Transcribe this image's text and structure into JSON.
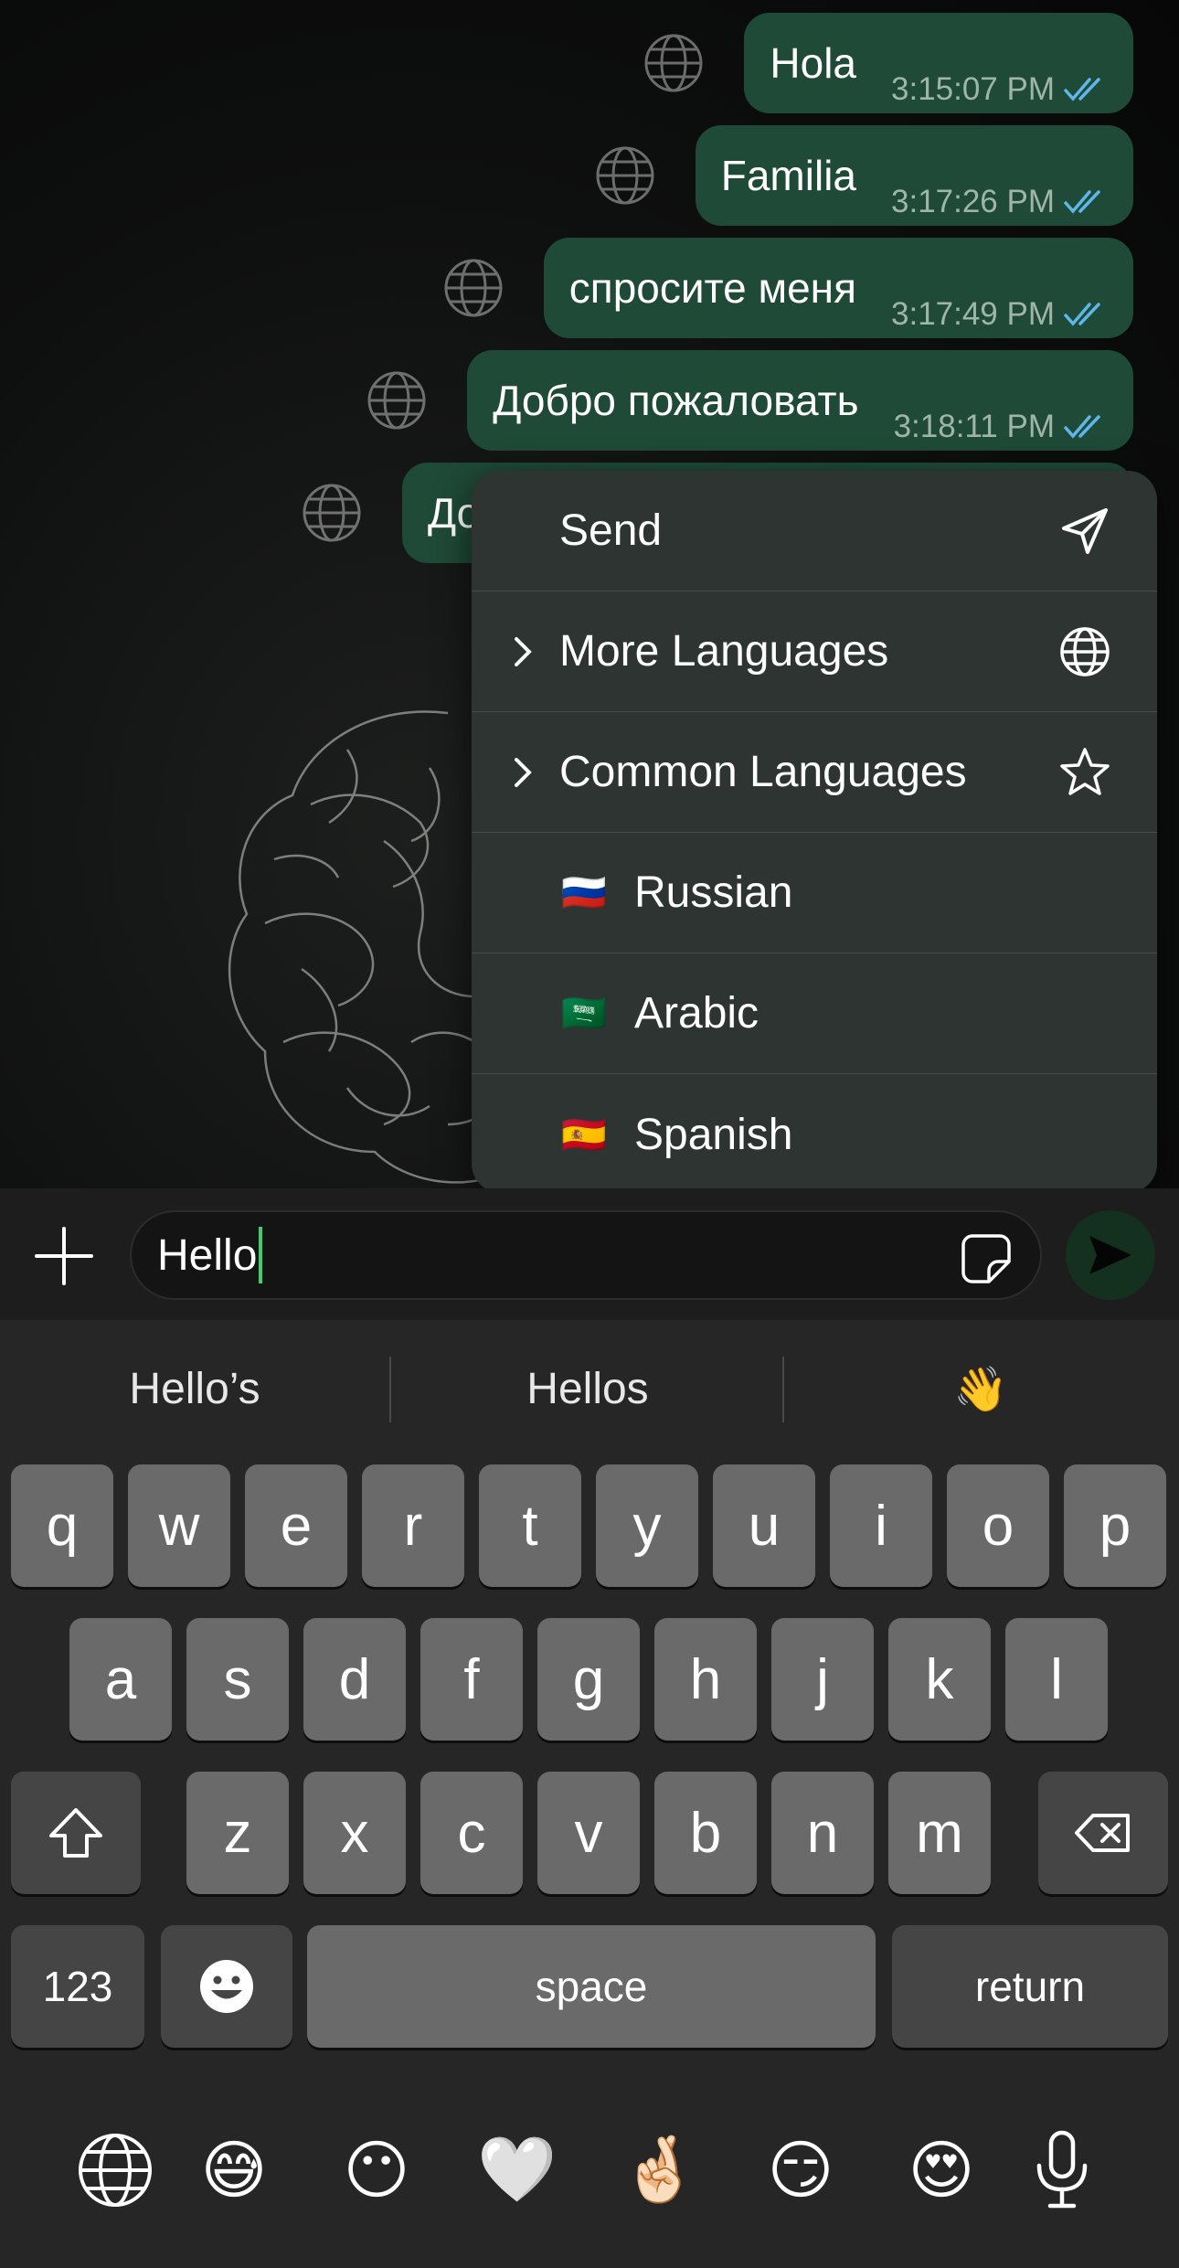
{
  "messages": [
    {
      "text": "Hola",
      "time": "3:15:07 PM"
    },
    {
      "text": "Familia",
      "time": "3:17:26 PM"
    },
    {
      "text": "спросите меня",
      "time": "3:17:49 PM"
    },
    {
      "text": "Добро пожаловать",
      "time": "3:18:11 PM"
    },
    {
      "text": "До",
      "time": ""
    }
  ],
  "menu": {
    "send": "Send",
    "more_languages": "More Languages",
    "common_languages": "Common Languages",
    "languages": [
      {
        "flag": "🇷🇺",
        "label": "Russian"
      },
      {
        "flag": "🇸🇦",
        "label": "Arabic"
      },
      {
        "flag": "🇪🇸",
        "label": "Spanish"
      }
    ]
  },
  "composer": {
    "input_value": "Hello"
  },
  "keyboard": {
    "suggestions": [
      "Hello’s",
      "Hellos",
      "👋"
    ],
    "row1": [
      "q",
      "w",
      "e",
      "r",
      "t",
      "y",
      "u",
      "i",
      "o",
      "p"
    ],
    "row2": [
      "a",
      "s",
      "d",
      "f",
      "g",
      "h",
      "j",
      "k",
      "l"
    ],
    "row3": [
      "z",
      "x",
      "c",
      "v",
      "b",
      "n",
      "m"
    ],
    "numbers_label": "123",
    "space_label": "space",
    "return_label": "return",
    "emoji_bar": [
      "😅",
      "😶",
      "🤍",
      "🤞🏻",
      "😏",
      "😍"
    ]
  },
  "colors": {
    "bubble": "#1f4a37",
    "caret": "#3fcf6a",
    "ticks": "#5fb6e8"
  },
  "icons": {
    "send": "paper-plane-icon",
    "globe": "globe-icon",
    "star": "star-icon",
    "plus": "plus-icon",
    "sticker": "sticker-icon",
    "shift": "shift-icon",
    "delete": "delete-icon",
    "emoji": "emoji-icon",
    "mic": "microphone-icon"
  }
}
